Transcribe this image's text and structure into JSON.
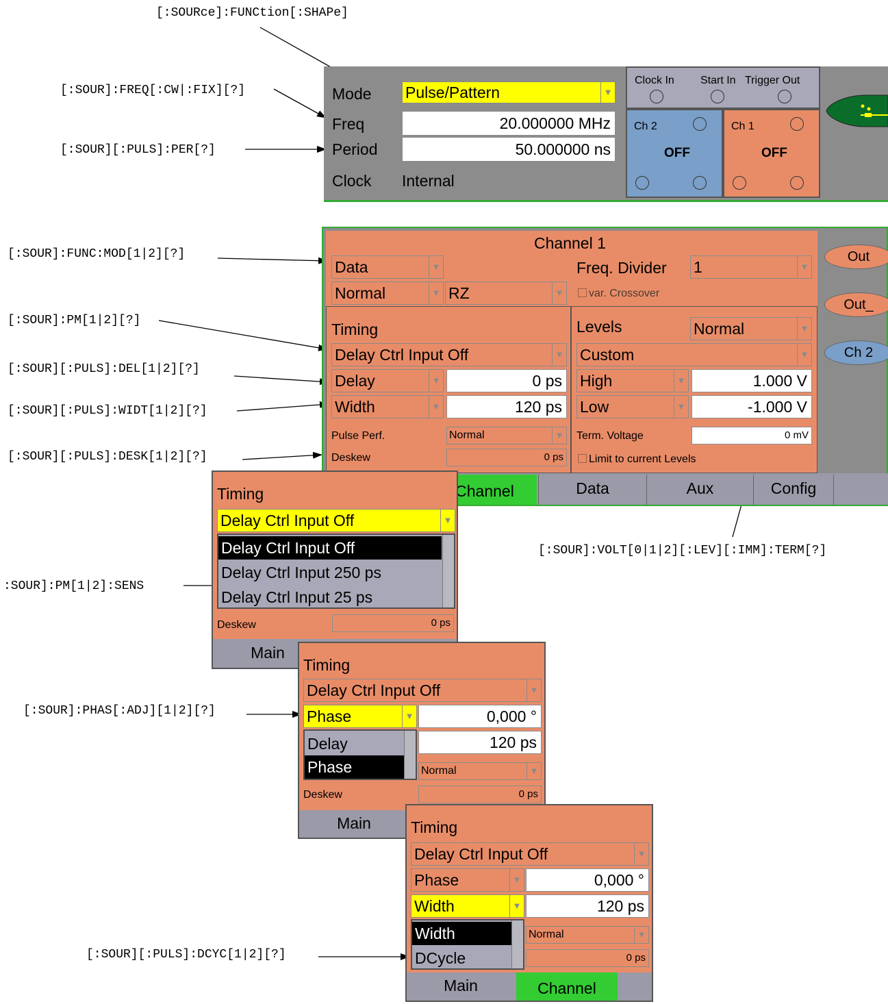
{
  "annotations": {
    "shape": "[:SOURce]:FUNCtion[:SHAPe]",
    "freq": "[:SOUR]:FREQ[:CW|:FIX][?]",
    "period": "[:SOUR][:PULS]:PER[?]",
    "func_mod": "[:SOUR]:FUNC:MOD[1|2][?]",
    "pm": "[:SOUR]:PM[1|2][?]",
    "delay": "[:SOUR][:PULS]:DEL[1|2][?]",
    "width": "[:SOUR][:PULS]:WIDT[1|2][?]",
    "deskew": "[:SOUR][:PULS]:DESK[1|2][?]",
    "term": "[:SOUR]:VOLT[0|1|2][:LEV][:IMM]:TERM[?]",
    "sens": ":SOUR]:PM[1|2]:SENS",
    "phase": "[:SOUR]:PHAS[:ADJ][1|2][?]",
    "dcyc": "[:SOUR][:PULS]:DCYC[1|2][?]"
  },
  "top_panel": {
    "mode_label": "Mode",
    "mode_value": "Pulse/Pattern",
    "freq_label": "Freq",
    "freq_value": "20.000000 MHz",
    "period_label": "Period",
    "period_value": "50.000000 ns",
    "clock_label": "Clock",
    "clock_value": "Internal",
    "clock_in": "Clock In",
    "start_in": "Start In",
    "trigger_out": "Trigger Out",
    "ch2_label": "Ch 2",
    "ch2_state": "OFF",
    "ch1_label": "Ch 1",
    "ch1_state": "OFF"
  },
  "channel_panel": {
    "title": "Channel 1",
    "data_mode": "Data",
    "freq_divider_label": "Freq. Divider",
    "freq_divider_value": "1",
    "polarity": "Normal",
    "format": "RZ",
    "var_crossover": "var. Crossover",
    "timing_label": "Timing",
    "delay_ctrl": "Delay Ctrl Input Off",
    "delay_label": "Delay",
    "delay_value": "0 ps",
    "width_label": "Width",
    "width_value": "120 ps",
    "pulse_perf_label": "Pulse Perf.",
    "pulse_perf_value": "Normal",
    "deskew_label": "Deskew",
    "deskew_value": "0 ps",
    "levels_label": "Levels",
    "levels_mode": "Normal",
    "levels_preset": "Custom",
    "high_label": "High",
    "high_value": "1.000 V",
    "low_label": "Low",
    "low_value": "-1.000 V",
    "term_label": "Term. Voltage",
    "term_value": "0 mV",
    "limit_label": "Limit to current Levels",
    "side_out": "Out",
    "side_out_n": "Out_",
    "side_ch2": "Ch 2",
    "tabs": [
      "Channel",
      "Data",
      "Aux",
      "Config"
    ]
  },
  "popup1": {
    "timing_label": "Timing",
    "selected": "Delay Ctrl Input Off",
    "options": [
      "Delay Ctrl Input Off",
      "Delay Ctrl Input 250 ps",
      "Delay Ctrl Input 25 ps"
    ],
    "deskew_label": "Deskew",
    "deskew_value": "0 ps",
    "tab_main": "Main"
  },
  "popup2": {
    "timing_label": "Timing",
    "delay_ctrl": "Delay Ctrl Input Off",
    "selected": "Phase",
    "phase_value": "0,000 °",
    "width_value": "120 ps",
    "options": [
      "Delay",
      "Phase"
    ],
    "pulse_perf_value": "Normal",
    "deskew_label": "Deskew",
    "deskew_value": "0 ps",
    "tab_main": "Main"
  },
  "popup3": {
    "timing_label": "Timing",
    "delay_ctrl": "Delay Ctrl Input Off",
    "phase_label": "Phase",
    "phase_value": "0,000 °",
    "selected": "Width",
    "width_value": "120 ps",
    "options": [
      "Width",
      "DCycle"
    ],
    "pulse_perf_value": "Normal",
    "deskew_value": "0 ps",
    "tab_main": "Main",
    "tab_channel": "Channel"
  },
  "colors": {
    "orange": "#e88c68",
    "gray": "#8c8c8c",
    "yellow": "#ffff00",
    "blue": "#7a9fc8",
    "green": "#33cc33",
    "tab_gray": "#9a9aa8"
  }
}
